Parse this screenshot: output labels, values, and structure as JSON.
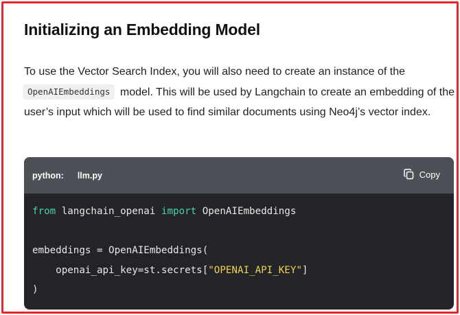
{
  "heading": "Initializing an Embedding Model",
  "paragraph": {
    "before": "To use the Vector Search Index, you will also need to create an instance of the",
    "code": "OpenAIEmbeddings",
    "after": "model. This will be used by Langchain to create an embedding of the user’s input which will be used to find similar documents using Neo4j’s vector index."
  },
  "code_block": {
    "language": "python:",
    "filename": "llm.py",
    "copy_label": "Copy",
    "copy_icon": "copy-icon",
    "lines": {
      "l1_kw1": "from",
      "l1_mod": " langchain_openai ",
      "l1_kw2": "import",
      "l1_name": " OpenAIEmbeddings",
      "l3": "embeddings = OpenAIEmbeddings(",
      "l4_pre": "    openai_api_key=st.secrets[",
      "l4_str": "\"OPENAI_API_KEY\"",
      "l4_post": "]",
      "l5": ")"
    }
  },
  "colors": {
    "frame": "#e5252a",
    "code_bg": "#232427",
    "code_header_bg": "#4d5056",
    "keyword": "#4fd0a8",
    "string": "#f2d257"
  }
}
